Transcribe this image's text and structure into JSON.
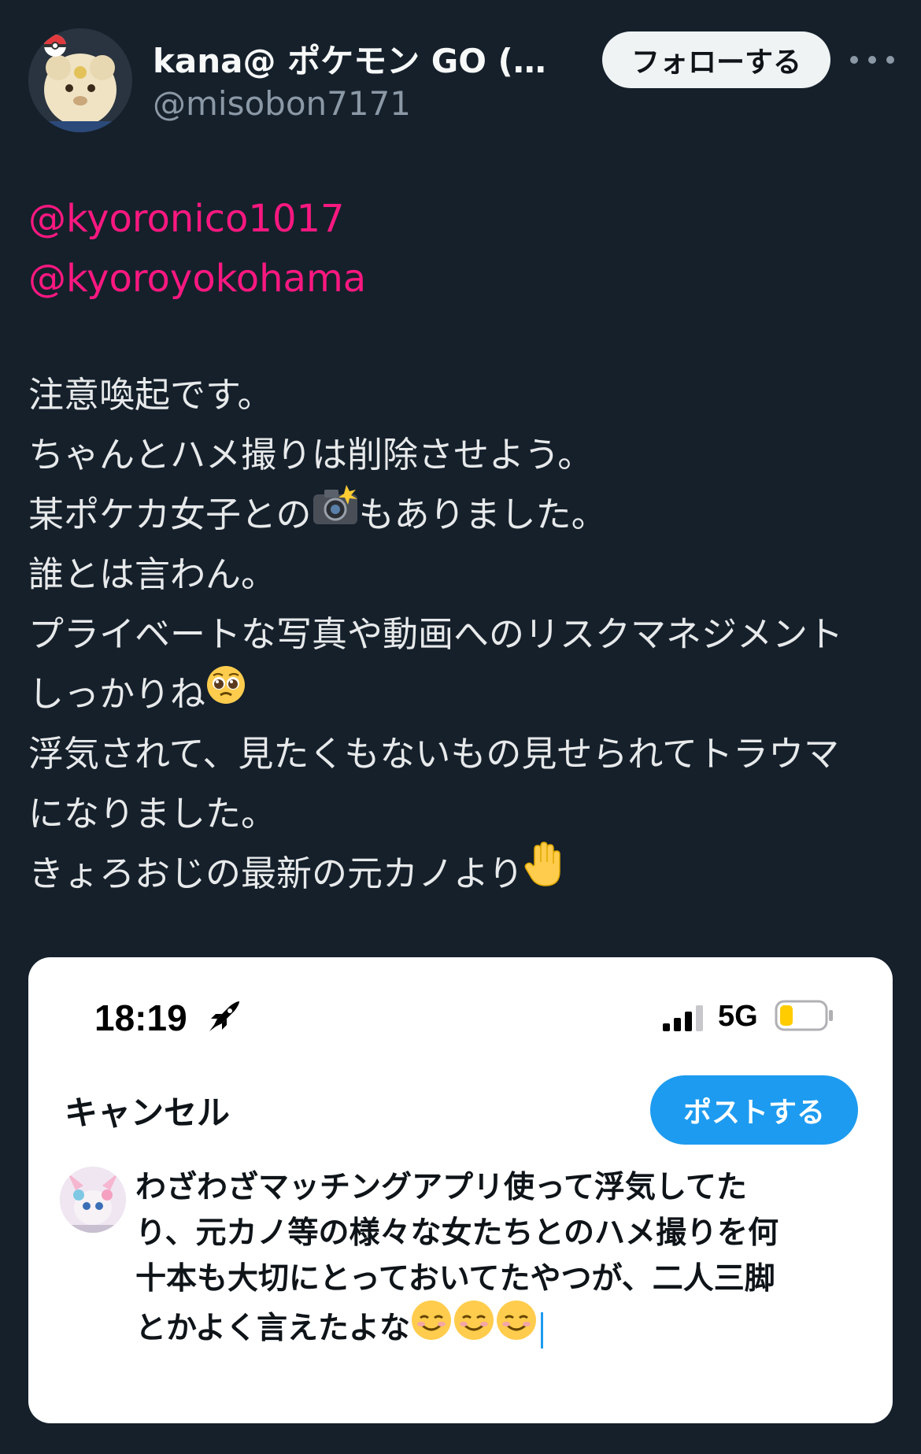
{
  "author": {
    "display_name": "kana@ ポケモン GO (Mis...",
    "handle": "@misobon7171",
    "follow_label": "フォローする"
  },
  "mentions": [
    "@kyoronico1017",
    "@kyoroyokohama"
  ],
  "tweet": {
    "line1": "注意喚起です。",
    "line2": "ちゃんとハメ撮りは削除させよう。",
    "line3_before": "某ポケカ女子との",
    "line3_after": "もありました。",
    "line4": "誰とは言わん。",
    "line5": "プライベートな写真や動画へのリスクマネジメント",
    "line6": "しっかりね",
    "line7": "浮気されて、見たくもないもの見せられてトラウマ",
    "line8": "になりました。",
    "line9": "きょろおじの最新の元カノより",
    "emojis": [
      "camera-flash-emoji",
      "pleading-face-emoji",
      "raised-hand-emoji"
    ]
  },
  "embedded_screenshot": {
    "status_time": "18:19",
    "network": "5G",
    "cancel_label": "キャンセル",
    "post_label": "ポストする",
    "compose_lines": [
      "わざわざマッチングアプリ使って浮気してた",
      "り、元カノ等の様々な女たちとのハメ撮りを何",
      "十本も大切にとっておいてたやつが、二人三脚",
      "とかよく言えたよな"
    ],
    "compose_emojis": [
      "smiling-face-emoji",
      "smiling-face-emoji",
      "smiling-face-emoji"
    ]
  },
  "colors": {
    "background": "#15202b",
    "mention": "#f91880",
    "text": "#e7e9ea",
    "muted": "#8b98a5",
    "accent": "#1d9bf0"
  }
}
